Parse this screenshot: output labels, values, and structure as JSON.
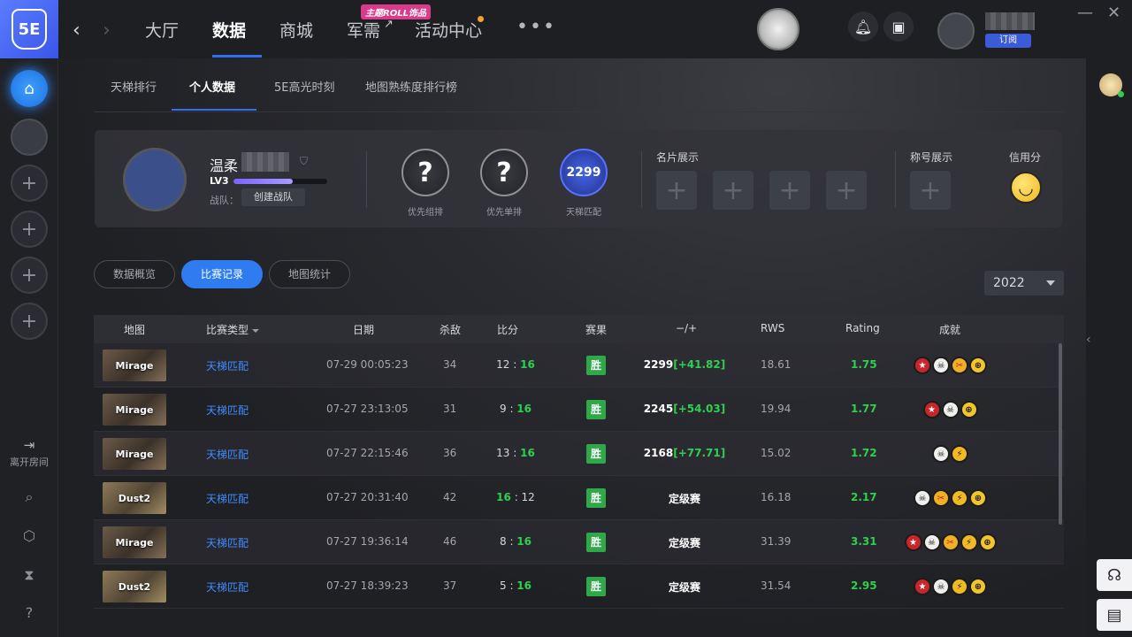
{
  "nav": {
    "items": [
      "大厅",
      "数据",
      "商城",
      "军需",
      "活动中心"
    ],
    "roll_badge": "主题ROLL饰品",
    "external_mark": "↗",
    "more": "•••",
    "subscribe": "订阅"
  },
  "rail": {
    "leave_room": "离开房间"
  },
  "subtabs": [
    "天梯排行",
    "个人数据",
    "5E高光时刻",
    "地图熟练度排行榜"
  ],
  "profile": {
    "name": "温柔",
    "level": "LV3",
    "level_progress": 0.63,
    "team_label": "战队：",
    "create_team": "创建战队",
    "ranks": [
      {
        "value": "?",
        "label": "优先组排"
      },
      {
        "value": "?",
        "label": "优先单排"
      },
      {
        "value": "2299",
        "label": "天梯匹配"
      }
    ],
    "cards_label": "名片展示",
    "title_label": "称号展示",
    "credit_label": "信用分"
  },
  "filters": [
    "数据概览",
    "比赛记录",
    "地图统计"
  ],
  "year": "2022",
  "table": {
    "headers": [
      "地图",
      "比赛类型",
      "日期",
      "杀敌",
      "比分",
      "赛果",
      "−/+",
      "RWS",
      "Rating",
      "成就"
    ],
    "rows": [
      {
        "map": "Mirage",
        "type": "天梯匹配",
        "date": "07-29 00:05:23",
        "kills": "34",
        "score_a": "12",
        "score_b": "16",
        "win_side": "b",
        "result": "胜",
        "elo": "2299",
        "delta": "[+41.82]",
        "rws": "18.61",
        "rating": "1.75",
        "badges": [
          "star",
          "skull",
          "knife",
          "target"
        ]
      },
      {
        "map": "Mirage",
        "type": "天梯匹配",
        "date": "07-27 23:13:05",
        "kills": "31",
        "score_a": "9",
        "score_b": "16",
        "win_side": "b",
        "result": "胜",
        "elo": "2245",
        "delta": "[+54.03]",
        "rws": "19.94",
        "rating": "1.77",
        "badges": [
          "star",
          "skull",
          "target"
        ]
      },
      {
        "map": "Mirage",
        "type": "天梯匹配",
        "date": "07-27 22:15:46",
        "kills": "36",
        "score_a": "13",
        "score_b": "16",
        "win_side": "b",
        "result": "胜",
        "elo": "2168",
        "delta": "[+77.71]",
        "rws": "15.02",
        "rating": "1.72",
        "badges": [
          "skull",
          "zeus"
        ]
      },
      {
        "map": "Dust2",
        "type": "天梯匹配",
        "date": "07-27 20:31:40",
        "kills": "42",
        "score_a": "16",
        "score_b": "12",
        "win_side": "a",
        "result": "胜",
        "elo": "定级赛",
        "delta": "",
        "rws": "16.18",
        "rating": "2.17",
        "badges": [
          "skull",
          "knife",
          "zeus",
          "target"
        ]
      },
      {
        "map": "Mirage",
        "type": "天梯匹配",
        "date": "07-27 19:36:14",
        "kills": "46",
        "score_a": "8",
        "score_b": "16",
        "win_side": "b",
        "result": "胜",
        "elo": "定级赛",
        "delta": "",
        "rws": "31.39",
        "rating": "3.31",
        "badges": [
          "star",
          "skull",
          "knife",
          "zeus",
          "target"
        ]
      },
      {
        "map": "Dust2",
        "type": "天梯匹配",
        "date": "07-27 18:39:23",
        "kills": "37",
        "score_a": "5",
        "score_b": "16",
        "win_side": "b",
        "result": "胜",
        "elo": "定级赛",
        "delta": "",
        "rws": "31.54",
        "rating": "2.95",
        "badges": [
          "star",
          "skull",
          "zeus",
          "target"
        ]
      }
    ]
  },
  "colors": {
    "accent": "#2f7bf0",
    "win_green": "#2fa84a",
    "positive": "#2ed050",
    "link": "#3f8cff"
  }
}
